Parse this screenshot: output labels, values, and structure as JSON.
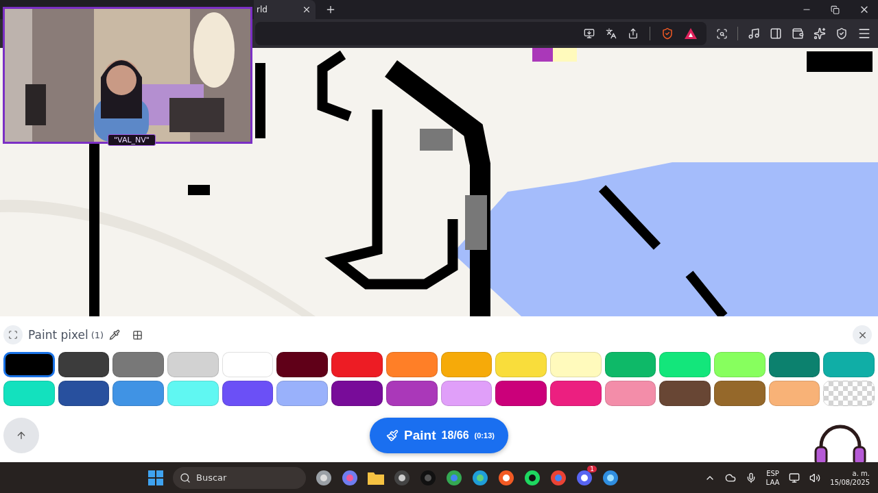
{
  "browser": {
    "tab": {
      "title": "rld"
    }
  },
  "webcam": {
    "caption": "\"VAL_NV\""
  },
  "paint_panel": {
    "title": "Paint pixel",
    "count": "(1)",
    "palette": [
      {
        "kind": "color",
        "color": "#000000",
        "selected": true
      },
      {
        "kind": "color",
        "color": "#3c3c3c",
        "selected": false
      },
      {
        "kind": "color",
        "color": "#787878",
        "selected": false
      },
      {
        "kind": "color",
        "color": "#d2d2d2",
        "selected": false
      },
      {
        "kind": "color",
        "color": "#ffffff",
        "selected": false
      },
      {
        "kind": "color",
        "color": "#600018",
        "selected": false
      },
      {
        "kind": "color",
        "color": "#ed1c24",
        "selected": false
      },
      {
        "kind": "color",
        "color": "#ff7f27",
        "selected": false
      },
      {
        "kind": "color",
        "color": "#f6aa09",
        "selected": false
      },
      {
        "kind": "color",
        "color": "#f9dd3b",
        "selected": false
      },
      {
        "kind": "color",
        "color": "#fffabc",
        "selected": false
      },
      {
        "kind": "color",
        "color": "#0eb968",
        "selected": false
      },
      {
        "kind": "color",
        "color": "#13e67b",
        "selected": false
      },
      {
        "kind": "color",
        "color": "#87ff5e",
        "selected": false
      },
      {
        "kind": "color",
        "color": "#0c816e",
        "selected": false
      },
      {
        "kind": "color",
        "color": "#10aea6",
        "selected": false
      },
      {
        "kind": "color",
        "color": "#13e1be",
        "selected": false
      },
      {
        "kind": "color",
        "color": "#28509e",
        "selected": false
      },
      {
        "kind": "color",
        "color": "#4093e4",
        "selected": false
      },
      {
        "kind": "color",
        "color": "#60f7f2",
        "selected": false
      },
      {
        "kind": "color",
        "color": "#6b50f6",
        "selected": false
      },
      {
        "kind": "color",
        "color": "#99b1fb",
        "selected": false
      },
      {
        "kind": "color",
        "color": "#780c99",
        "selected": false
      },
      {
        "kind": "color",
        "color": "#aa38b9",
        "selected": false
      },
      {
        "kind": "color",
        "color": "#e09ff9",
        "selected": false
      },
      {
        "kind": "color",
        "color": "#cb007a",
        "selected": false
      },
      {
        "kind": "color",
        "color": "#ec1f80",
        "selected": false
      },
      {
        "kind": "color",
        "color": "#f38da9",
        "selected": false
      },
      {
        "kind": "color",
        "color": "#684634",
        "selected": false
      },
      {
        "kind": "color",
        "color": "#95682a",
        "selected": false
      },
      {
        "kind": "color",
        "color": "#f8b277",
        "selected": false
      },
      {
        "kind": "transparent",
        "selected": false
      }
    ],
    "paint_button": {
      "label": "Paint",
      "charges": "18/66",
      "cooldown": "(0:13)"
    }
  },
  "taskbar": {
    "search": {
      "placeholder": "Buscar"
    },
    "notification_badge": "1",
    "language": "ESP",
    "layout": "LAA",
    "time": "a. m.",
    "date": "15/08/2025"
  }
}
